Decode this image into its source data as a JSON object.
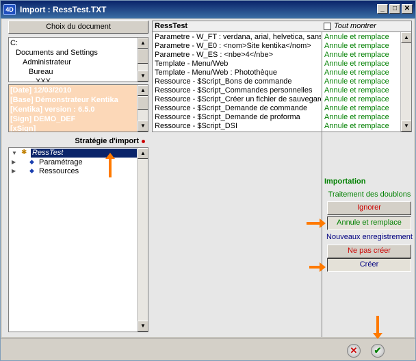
{
  "window": {
    "title": "Import : RessTest.TXT",
    "logo": "4D"
  },
  "left": {
    "choose_doc_label": "Choix du document",
    "path_items": [
      "C:",
      "Documents and Settings",
      "Administrateur",
      "Bureau",
      "XXX"
    ],
    "info_lines": [
      "[Date] 12/03/2010",
      "[Base] Démonstrateur Kentika",
      "[Kentika] version : 6.5.0",
      "[Sign] DEMO_DEF",
      "[xSign]"
    ],
    "strategy_label": "Stratégie d'import",
    "tree": [
      {
        "label": "RessTest",
        "expanded": true,
        "selected": true
      },
      {
        "label": "Paramétrage",
        "expanded": false,
        "selected": false
      },
      {
        "label": "Ressources",
        "expanded": false,
        "selected": false
      }
    ]
  },
  "list": {
    "header_name": "RessTest",
    "show_all_label": "Tout montrer",
    "rows": [
      {
        "name": "Parametre - W_FT : verdana, arial, helvetica, sans-",
        "action": "Annule et remplace"
      },
      {
        "name": "Parametre - W_E0 : <nom>Site kentika</nom>",
        "action": "Annule et remplace"
      },
      {
        "name": "Parametre - W_ES : <nbe>4</nbe>",
        "action": "Annule et remplace"
      },
      {
        "name": "Template - Menu/Web",
        "action": "Annule et remplace"
      },
      {
        "name": "Template - Menu/Web : Photothèque",
        "action": "Annule et remplace"
      },
      {
        "name": "Ressource - $Script_Bons de commande",
        "action": "Annule et remplace"
      },
      {
        "name": "Ressource - $Script_Commandes personnelles",
        "action": "Annule et remplace"
      },
      {
        "name": "Ressource - $Script_Créer un fichier de sauvegarde",
        "action": "Annule et remplace"
      },
      {
        "name": "Ressource - $Script_Demande de commande",
        "action": "Annule et remplace"
      },
      {
        "name": "Ressource - $Script_Demande de proforma",
        "action": "Annule et remplace"
      },
      {
        "name": "Ressource - $Script_DSI",
        "action": "Annule et remplace"
      }
    ]
  },
  "import_panel": {
    "title": "Importation",
    "duplicates_label": "Traitement des doublons",
    "ignore_label": "Ignorer",
    "replace_label": "Annule et remplace",
    "new_records_label": "Nouveaux enregistrement",
    "dont_create_label": "Ne pas créer",
    "create_label": "Créer"
  },
  "colors": {
    "green": "#008000",
    "red": "#cc0000",
    "blue": "#000080",
    "peach": "#fcd8b8",
    "arrow": "#ff7a00"
  }
}
